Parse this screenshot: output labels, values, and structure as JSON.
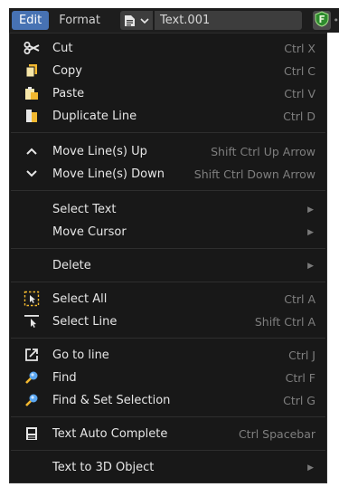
{
  "header": {
    "tabs": [
      {
        "label": "Edit",
        "active": true
      },
      {
        "label": "Format",
        "active": false
      }
    ],
    "text_block_name": "Text.001",
    "icons": [
      "document-icon",
      "chevron-down-icon",
      "font-badge-icon"
    ]
  },
  "menu": {
    "items": [
      {
        "label": "Cut",
        "shortcut": "Ctrl X",
        "icon": "scissors-icon"
      },
      {
        "label": "Copy",
        "shortcut": "Ctrl C",
        "icon": "copy-icon"
      },
      {
        "label": "Paste",
        "shortcut": "Ctrl V",
        "icon": "paste-icon"
      },
      {
        "label": "Duplicate Line",
        "shortcut": "Ctrl D",
        "icon": "duplicate-icon"
      },
      {
        "label": "Move Line(s) Up",
        "shortcut": "Shift Ctrl Up Arrow",
        "icon": "chevron-up-icon"
      },
      {
        "label": "Move Line(s) Down",
        "shortcut": "Shift Ctrl Down Arrow",
        "icon": "chevron-down-icon"
      },
      {
        "label": "Select Text",
        "submenu": true
      },
      {
        "label": "Move Cursor",
        "submenu": true
      },
      {
        "label": "Delete",
        "submenu": true
      },
      {
        "label": "Select All",
        "shortcut": "Ctrl A",
        "icon": "select-all-icon"
      },
      {
        "label": "Select Line",
        "shortcut": "Shift Ctrl A",
        "icon": "select-line-icon"
      },
      {
        "label": "Go to line",
        "shortcut": "Ctrl J",
        "icon": "go-to-icon"
      },
      {
        "label": "Find",
        "shortcut": "Ctrl F",
        "icon": "find-icon"
      },
      {
        "label": "Find & Set Selection",
        "shortcut": "Ctrl G",
        "icon": "find-select-icon"
      },
      {
        "label": "Text Auto Complete",
        "shortcut": "Ctrl Spacebar",
        "icon": "autocomplete-icon"
      },
      {
        "label": "Text to 3D Object",
        "submenu": true
      }
    ]
  },
  "colors": {
    "accent": "#4772b3",
    "menu_bg": "#181818",
    "text": "#e6e6e6",
    "shortcut": "#7f7f7f",
    "separator": "#2e2e2e",
    "icon_orange": "#f2b830",
    "icon_blue": "#5aa6f0",
    "badge_green": "#2e8b2e"
  }
}
